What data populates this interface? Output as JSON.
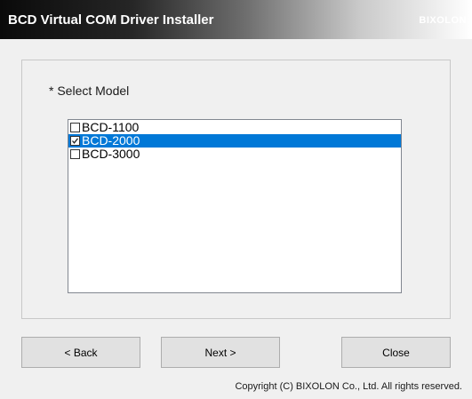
{
  "window": {
    "title": "BCD Virtual COM Driver Installer",
    "brand": "BIXOLON"
  },
  "model_panel": {
    "label": "* Select Model",
    "models": [
      {
        "label": "BCD-1100",
        "checked": false,
        "selected": false
      },
      {
        "label": "BCD-2000",
        "checked": true,
        "selected": true
      },
      {
        "label": "BCD-3000",
        "checked": false,
        "selected": false
      }
    ]
  },
  "buttons": {
    "back": "< Back",
    "next": "Next >",
    "close": "Close"
  },
  "footer": {
    "copyright": "Copyright (C) BIXOLON Co., Ltd. All rights reserved."
  },
  "colors": {
    "selection": "#0078d7",
    "button_face": "#e1e1e1"
  }
}
